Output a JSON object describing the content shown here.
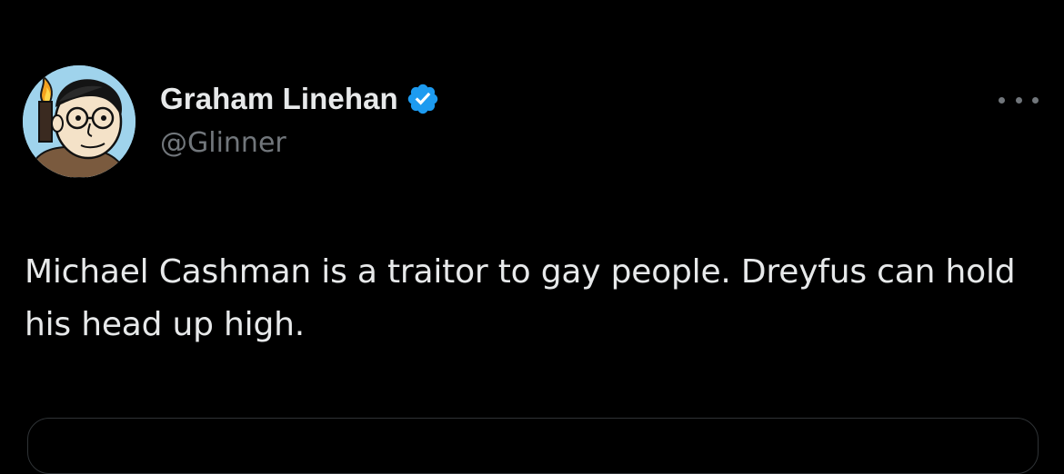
{
  "tweet": {
    "author": {
      "display_name": "Graham Linehan",
      "handle": "@Glinner",
      "verified": true,
      "verified_icon": "verified-badge-icon",
      "avatar": "cartoon-portrait-avatar"
    },
    "text": "Michael Cashman is a traitor to gay people. Dreyfus can hold his head up high.",
    "more_icon": "more-options-icon"
  },
  "colors": {
    "background": "#000000",
    "primary_text": "#e7e9ea",
    "secondary_text": "#71767b",
    "verified_blue": "#1d9bf0",
    "border": "#2f3336"
  }
}
